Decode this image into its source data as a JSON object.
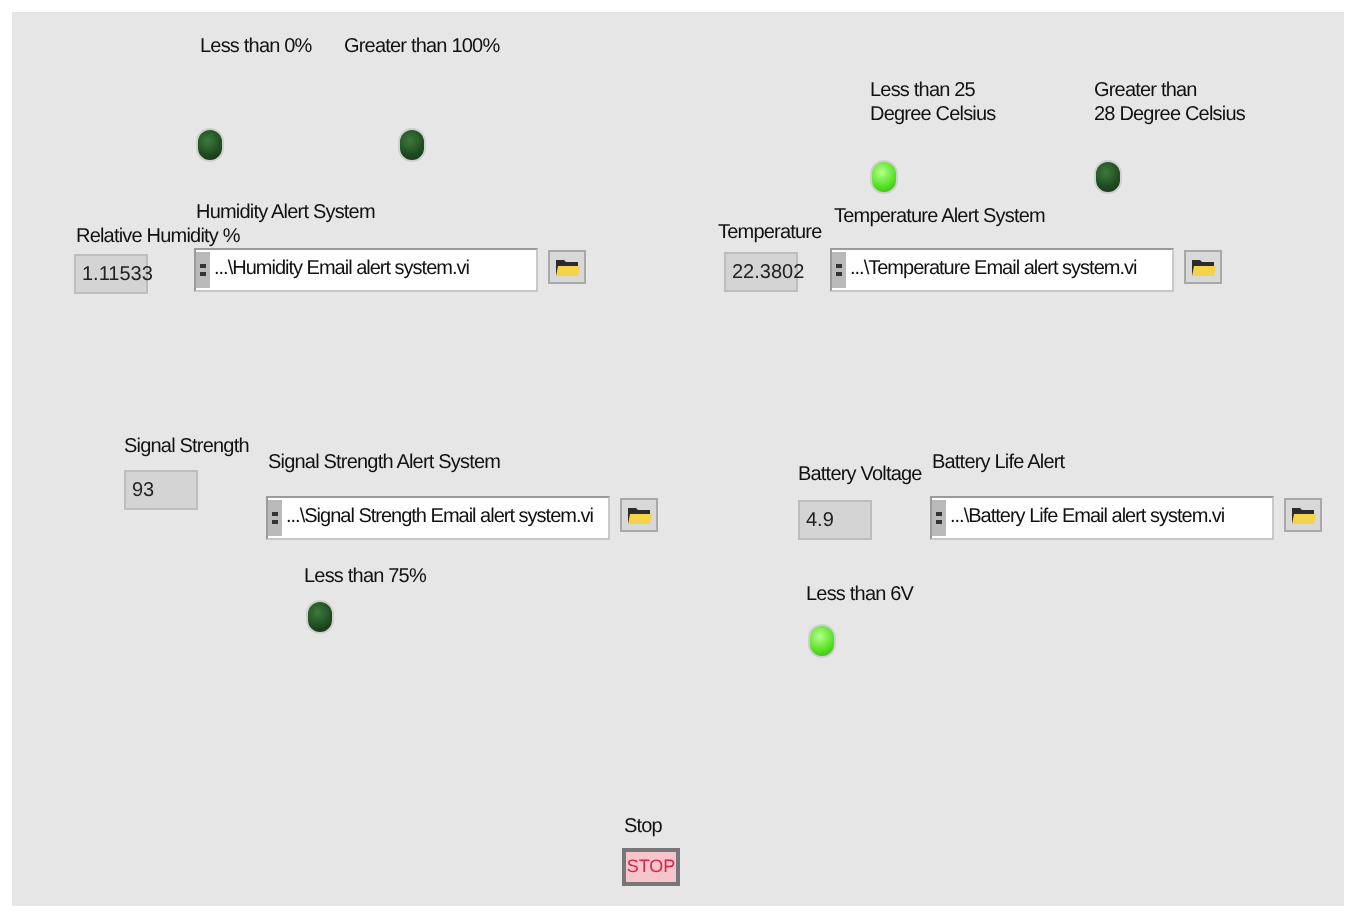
{
  "sections": [
    {
      "numeric": {
        "label": "Relative Humidity %",
        "value": "1.11533"
      },
      "path_control": {
        "label": "Humidity Alert System",
        "value": "...\\Humidity Email alert system.vi"
      },
      "leds": [
        {
          "label": "Less than 0%",
          "on": false
        },
        {
          "label": "Greater than 100%",
          "on": false
        }
      ]
    },
    {
      "numeric": {
        "label": "Temperature",
        "value": "22.3802"
      },
      "path_control": {
        "label": "Temperature Alert System",
        "value": "...\\Temperature Email alert system.vi"
      },
      "leds": [
        {
          "label": "Less than 25\nDegree Celsius",
          "on": true
        },
        {
          "label": "Greater than\n28 Degree Celsius",
          "on": false
        }
      ]
    },
    {
      "numeric": {
        "label": "Signal Strength",
        "value": "93"
      },
      "path_control": {
        "label": "Signal Strength Alert System",
        "value": "...\\Signal Strength Email alert system.vi"
      },
      "leds": [
        {
          "label": "Less than 75%",
          "on": false
        }
      ]
    },
    {
      "numeric": {
        "label": "Battery Voltage",
        "value": "4.9"
      },
      "path_control": {
        "label": "Battery Life Alert",
        "value": "...\\Battery Life Email alert system.vi"
      },
      "leds": [
        {
          "label": "Less than 6V",
          "on": true
        }
      ]
    }
  ],
  "stop_button": {
    "label": "Stop",
    "text": "STOP"
  }
}
